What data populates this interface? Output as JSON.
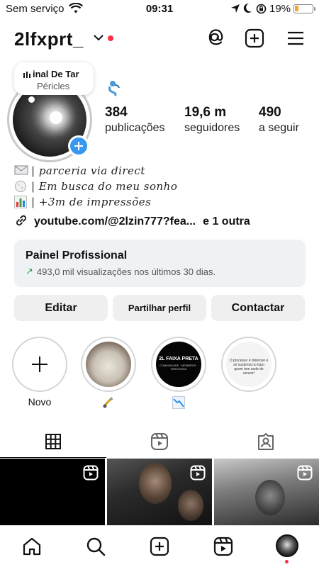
{
  "status": {
    "carrier": "Sem serviço",
    "time": "09:31",
    "battery": "19%",
    "battery_level": 0.19
  },
  "profile": {
    "username": "2lfxprt_",
    "note": {
      "song": "inal De Tar",
      "artist": "Péricles"
    },
    "stats": [
      {
        "value": "384",
        "label": "publicações"
      },
      {
        "value": "19,6 m",
        "label": "seguidores"
      },
      {
        "value": "490",
        "label": "a seguir"
      }
    ],
    "bio": [
      {
        "icon": "envelope-icon",
        "text": "| parceria via direct"
      },
      {
        "icon": "moon-icon",
        "text": "| Em busca do meu sonho"
      },
      {
        "icon": "bar-chart-icon",
        "text": "| +3m de impressões"
      }
    ],
    "link": {
      "url": "youtube.com/@2lzin777?fea...",
      "more": "e 1 outra"
    }
  },
  "dashboard": {
    "title": "Painel Profissional",
    "subtitle": "493,0 mil visualizações nos últimos 30 dias."
  },
  "buttons": {
    "edit": "Editar",
    "share": "Partilhar perfil",
    "contact": "Contactar"
  },
  "highlights": [
    {
      "label": "Novo"
    },
    {
      "label": ""
    },
    {
      "label": "",
      "cover_title": "2L FAIXA PRETA",
      "cover_sub": "COMUNIDADE · MEMBROS · PARCERIAS"
    },
    {
      "label": "",
      "cover_text": "O processo é doloroso e só sustenta no topo quem tem sede de vencer!"
    }
  ],
  "colors": {
    "accent_blue": "#3897f0",
    "notification_red": "#ff3040",
    "growth_green": "#2aa44f",
    "card_bg": "#eff2f5",
    "button_bg": "#efefef"
  }
}
